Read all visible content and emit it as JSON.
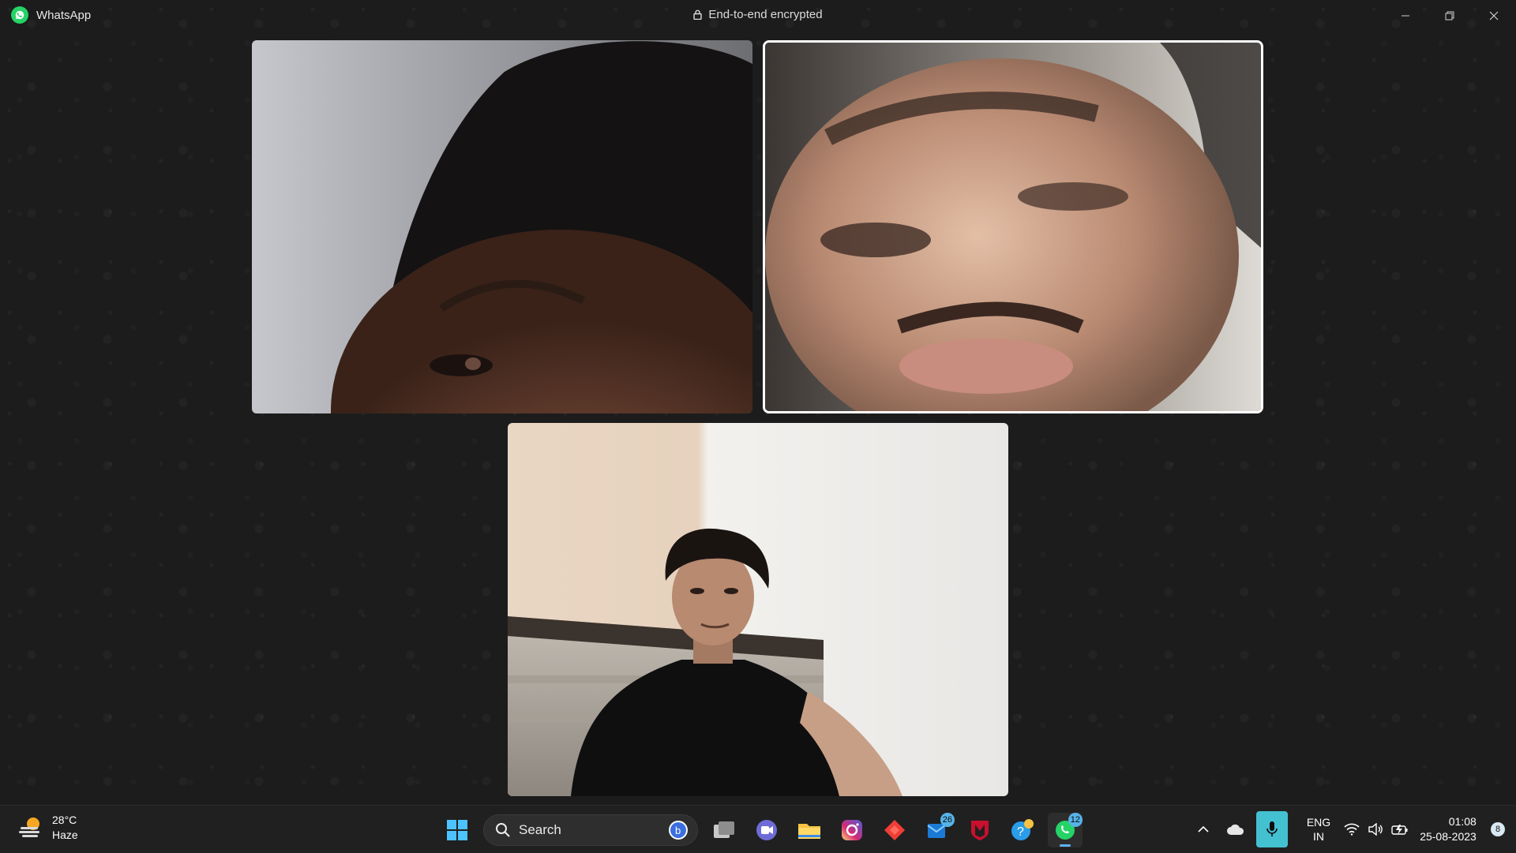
{
  "window": {
    "app_name": "WhatsApp",
    "encryption_text": "End-to-end encrypted",
    "controls": [
      "minimize-icon",
      "restore-icon",
      "close-icon"
    ]
  },
  "call": {
    "participants": [
      {
        "id": "participant-1",
        "highlighted": false
      },
      {
        "id": "participant-2",
        "highlighted": true
      },
      {
        "id": "participant-3",
        "highlighted": false
      }
    ]
  },
  "taskbar": {
    "weather": {
      "temp": "28°C",
      "condition": "Haze"
    },
    "search_label": "Search",
    "apps": [
      {
        "name": "task-view-icon"
      },
      {
        "name": "meet-icon"
      },
      {
        "name": "file-explorer-icon"
      },
      {
        "name": "instagram-icon"
      },
      {
        "name": "anydesk-icon"
      },
      {
        "name": "mail-icon",
        "badge": "26"
      },
      {
        "name": "mcafee-icon"
      },
      {
        "name": "help-icon"
      },
      {
        "name": "whatsapp-icon",
        "badge": "12",
        "active": true
      }
    ],
    "language": {
      "line1": "ENG",
      "line2": "IN"
    },
    "time": "01:08",
    "date": "25-08-2023",
    "notification_count": "8"
  },
  "colors": {
    "background": "#1c1c1c",
    "taskbar": "#202020",
    "whatsapp_green": "#25d366",
    "accent": "#5fb2f2"
  }
}
